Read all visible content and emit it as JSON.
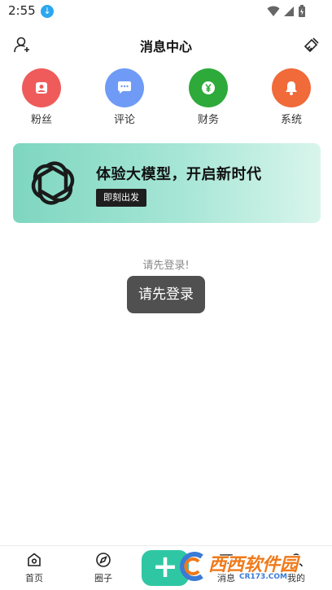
{
  "status_bar": {
    "time": "2:55"
  },
  "header": {
    "title": "消息中心"
  },
  "categories": [
    {
      "label": "粉丝",
      "color": "#ef5b5b",
      "icon": "person-icon"
    },
    {
      "label": "评论",
      "color": "#6f9bf6",
      "icon": "comment-bubble-icon"
    },
    {
      "label": "财务",
      "color": "#2eaa3b",
      "icon": "yen-coin-icon"
    },
    {
      "label": "系统",
      "color": "#f06a3a",
      "icon": "bell-icon"
    }
  ],
  "banner": {
    "title": "体验大模型，开启新时代",
    "button": "即刻出发"
  },
  "empty_state": {
    "hint": "请先登录!",
    "login_button": "请先登录"
  },
  "bottom_nav": [
    {
      "label": "首页",
      "icon": "home-icon"
    },
    {
      "label": "圈子",
      "icon": "compass-icon"
    },
    {
      "label": "",
      "icon": "plus-icon"
    },
    {
      "label": "消息",
      "icon": "message-icon"
    },
    {
      "label": "我的",
      "icon": "profile-icon"
    }
  ],
  "watermark": {
    "text": "西西软件园",
    "sub": "CR173.COM"
  },
  "colors": {
    "accent": "#2fc7a3",
    "banner_start": "#7ed6c0",
    "banner_end": "#d9f5ec"
  }
}
